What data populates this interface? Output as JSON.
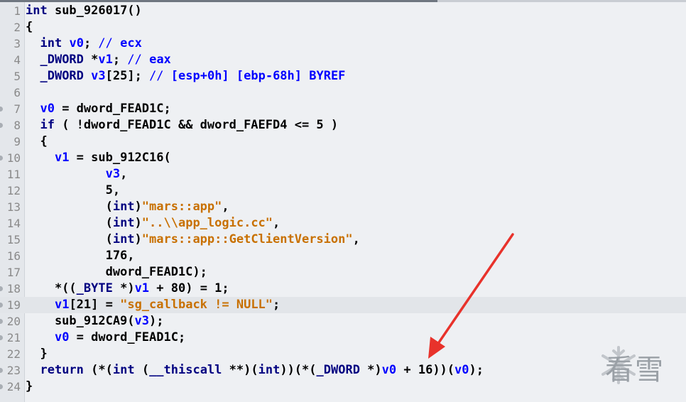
{
  "editor": {
    "lines": [
      {
        "num": "1",
        "dot": false,
        "hl": false,
        "tokens": [
          [
            "k",
            "int"
          ],
          [
            "n",
            " sub_926017()"
          ]
        ]
      },
      {
        "num": "2",
        "dot": false,
        "hl": false,
        "tokens": [
          [
            "n",
            "{"
          ]
        ]
      },
      {
        "num": "3",
        "dot": false,
        "hl": false,
        "tokens": [
          [
            "n",
            "  "
          ],
          [
            "k",
            "int"
          ],
          [
            "n",
            " "
          ],
          [
            "v",
            "v0"
          ],
          [
            "n",
            "; "
          ],
          [
            "c",
            "// "
          ],
          [
            "v",
            "ecx"
          ]
        ]
      },
      {
        "num": "4",
        "dot": false,
        "hl": false,
        "tokens": [
          [
            "n",
            "  "
          ],
          [
            "t",
            "_DWORD"
          ],
          [
            "n",
            " *"
          ],
          [
            "v",
            "v1"
          ],
          [
            "n",
            "; "
          ],
          [
            "c",
            "// "
          ],
          [
            "v",
            "eax"
          ]
        ]
      },
      {
        "num": "5",
        "dot": false,
        "hl": false,
        "tokens": [
          [
            "n",
            "  "
          ],
          [
            "t",
            "_DWORD"
          ],
          [
            "n",
            " "
          ],
          [
            "v",
            "v3"
          ],
          [
            "n",
            "[25]; "
          ],
          [
            "c",
            "// "
          ],
          [
            "v",
            "[esp+0h] [ebp-68h] BYREF"
          ]
        ]
      },
      {
        "num": "6",
        "dot": false,
        "hl": false,
        "tokens": []
      },
      {
        "num": "7",
        "dot": true,
        "hl": false,
        "tokens": [
          [
            "n",
            "  "
          ],
          [
            "v",
            "v0"
          ],
          [
            "n",
            " = dword_FEAD1C;"
          ]
        ]
      },
      {
        "num": "8",
        "dot": true,
        "hl": false,
        "tokens": [
          [
            "n",
            "  "
          ],
          [
            "k",
            "if"
          ],
          [
            "n",
            " ( !dword_FEAD1C && dword_FAEFD4 <= 5 )"
          ]
        ]
      },
      {
        "num": "9",
        "dot": false,
        "hl": false,
        "tokens": [
          [
            "n",
            "  {"
          ]
        ]
      },
      {
        "num": "10",
        "dot": true,
        "hl": false,
        "tokens": [
          [
            "n",
            "    "
          ],
          [
            "v",
            "v1"
          ],
          [
            "n",
            " = sub_912C16("
          ]
        ]
      },
      {
        "num": "11",
        "dot": false,
        "hl": false,
        "tokens": [
          [
            "n",
            "           "
          ],
          [
            "v",
            "v3"
          ],
          [
            "n",
            ","
          ]
        ]
      },
      {
        "num": "12",
        "dot": false,
        "hl": false,
        "tokens": [
          [
            "n",
            "           5,"
          ]
        ]
      },
      {
        "num": "13",
        "dot": false,
        "hl": false,
        "tokens": [
          [
            "n",
            "           ("
          ],
          [
            "k",
            "int"
          ],
          [
            "n",
            ")"
          ],
          [
            "s",
            "\"mars::app\""
          ],
          [
            "n",
            ","
          ]
        ]
      },
      {
        "num": "14",
        "dot": false,
        "hl": false,
        "tokens": [
          [
            "n",
            "           ("
          ],
          [
            "k",
            "int"
          ],
          [
            "n",
            ")"
          ],
          [
            "s",
            "\"..\\\\app_logic.cc\""
          ],
          [
            "n",
            ","
          ]
        ]
      },
      {
        "num": "15",
        "dot": false,
        "hl": false,
        "tokens": [
          [
            "n",
            "           ("
          ],
          [
            "k",
            "int"
          ],
          [
            "n",
            ")"
          ],
          [
            "s",
            "\"mars::app::GetClientVersion\""
          ],
          [
            "n",
            ","
          ]
        ]
      },
      {
        "num": "16",
        "dot": false,
        "hl": false,
        "tokens": [
          [
            "n",
            "           176,"
          ]
        ]
      },
      {
        "num": "17",
        "dot": false,
        "hl": false,
        "tokens": [
          [
            "n",
            "           dword_FEAD1C);"
          ]
        ]
      },
      {
        "num": "18",
        "dot": true,
        "hl": false,
        "tokens": [
          [
            "n",
            "    *(("
          ],
          [
            "t",
            "_BYTE"
          ],
          [
            "n",
            " *)"
          ],
          [
            "v",
            "v1"
          ],
          [
            "n",
            " + 80) = 1;"
          ]
        ]
      },
      {
        "num": "19",
        "dot": true,
        "hl": true,
        "tokens": [
          [
            "n",
            "    "
          ],
          [
            "v",
            "v1"
          ],
          [
            "n",
            "[21] = "
          ],
          [
            "s",
            "\"sg_callback != NULL\""
          ],
          [
            "n",
            ";"
          ]
        ]
      },
      {
        "num": "20",
        "dot": true,
        "hl": false,
        "tokens": [
          [
            "n",
            "    sub_912CA9("
          ],
          [
            "v",
            "v3"
          ],
          [
            "n",
            ");"
          ]
        ]
      },
      {
        "num": "21",
        "dot": true,
        "hl": false,
        "tokens": [
          [
            "n",
            "    "
          ],
          [
            "v",
            "v0"
          ],
          [
            "n",
            " = dword_FEAD1C;"
          ]
        ]
      },
      {
        "num": "22",
        "dot": false,
        "hl": false,
        "tokens": [
          [
            "n",
            "  }"
          ]
        ]
      },
      {
        "num": "23",
        "dot": true,
        "hl": false,
        "tokens": [
          [
            "n",
            "  "
          ],
          [
            "k",
            "return"
          ],
          [
            "n",
            " (*("
          ],
          [
            "k",
            "int"
          ],
          [
            "n",
            " ("
          ],
          [
            "k",
            "__thiscall"
          ],
          [
            "n",
            " **)("
          ],
          [
            "k",
            "int"
          ],
          [
            "n",
            "))(*("
          ],
          [
            "t",
            "_DWORD"
          ],
          [
            "n",
            " *)"
          ],
          [
            "v",
            "v0"
          ],
          [
            "n",
            " + 16))("
          ],
          [
            "v",
            "v0"
          ],
          [
            "n",
            ");"
          ]
        ]
      },
      {
        "num": "24",
        "dot": true,
        "hl": false,
        "tokens": [
          [
            "n",
            "}"
          ]
        ]
      }
    ]
  },
  "colors": {
    "keyword": "#000080",
    "variable": "#0000ff",
    "string": "#c87000",
    "arrow": "#e8322b"
  },
  "watermark": {
    "text": "看雪",
    "icon": "snowflake-icon"
  }
}
